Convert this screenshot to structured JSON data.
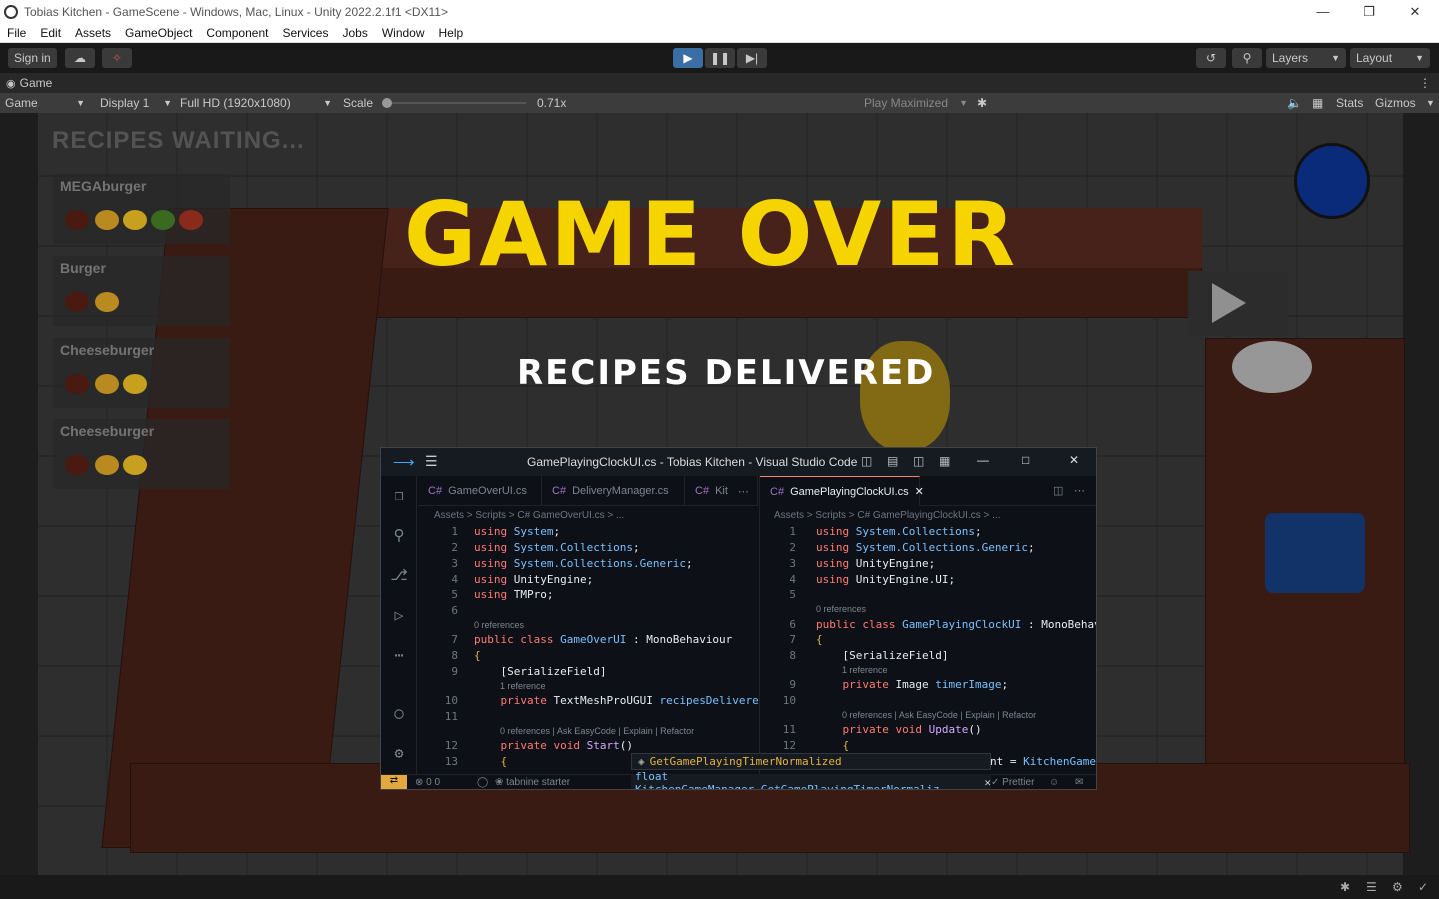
{
  "window": {
    "title": "Tobias Kitchen - GameScene - Windows, Mac, Linux - Unity 2022.2.1f1 <DX11>"
  },
  "menu": [
    "File",
    "Edit",
    "Assets",
    "GameObject",
    "Component",
    "Services",
    "Jobs",
    "Window",
    "Help"
  ],
  "toolbar": {
    "sign_in": "Sign in",
    "layers": "Layers",
    "layout": "Layout"
  },
  "tab": {
    "label": "Game"
  },
  "gamebar": {
    "mode": "Game",
    "display": "Display 1",
    "resolution": "Full HD (1920x1080)",
    "scale_label": "Scale",
    "scale_value": "0.71x",
    "play_mode": "Play Maximized",
    "stats": "Stats",
    "gizmos": "Gizmos"
  },
  "game": {
    "recipes_title": "RECIPES WAITING...",
    "recipes": [
      "MEGAburger",
      "Burger",
      "Cheeseburger",
      "Cheeseburger"
    ],
    "game_over": "GAME OVER",
    "delivered_label": "RECIPES DELIVERED"
  },
  "vscode": {
    "title": "GamePlayingClockUI.cs - Tobias Kitchen - Visual Studio Code",
    "left_tabs": [
      "GameOverUI.cs",
      "DeliveryManager.cs",
      "Kit"
    ],
    "right_tab": "GamePlayingClockUI.cs",
    "left_crumb": "Assets  >  Scripts  >  C#  GameOverUI.cs  > ...",
    "right_crumb": "Assets  >  Scripts  >  C#  GamePlayingClockUI.cs  > ...",
    "suggest": "GetGamePlayingTimerNormalized",
    "hover": "float KitchenGameManager.GetGamePlayingTimerNormaliz",
    "status_left": "0  0",
    "status_tabnine": "tabnine starter",
    "status_prettier": "Prettier"
  }
}
